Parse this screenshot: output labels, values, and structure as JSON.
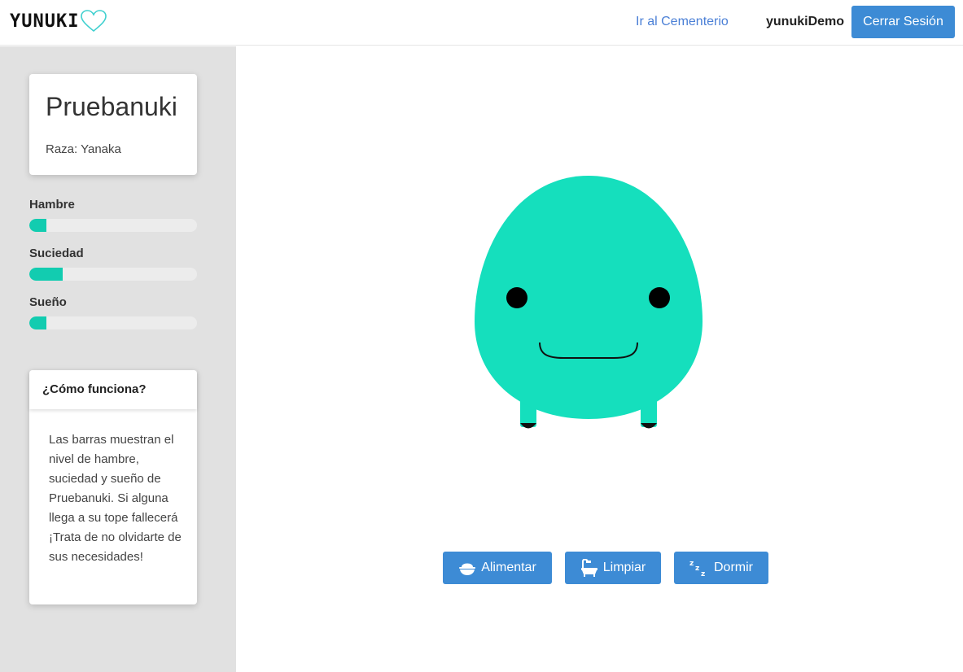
{
  "header": {
    "brand": "YUNUKI",
    "graveyard_link": "Ir al Cementerio",
    "username": "yunukiDemo",
    "logout_label": "Cerrar Sesión",
    "accent_color": "#3d8bd5"
  },
  "pet": {
    "name": "Pruebanuki",
    "breed_text": "Raza: Yanaka",
    "body_color": "#15dfbd"
  },
  "stats": [
    {
      "label": "Hambre",
      "level_percent": 10
    },
    {
      "label": "Suciedad",
      "level_percent": 20
    },
    {
      "label": "Sueño",
      "level_percent": 10
    }
  ],
  "help": {
    "title": "¿Cómo funciona?",
    "body": "Las barras muestran el nivel de hambre, suciedad y sueño de Pruebanuki. Si alguna llega a su tope fallecerá ¡Trata de no olvidarte de sus necesidades!"
  },
  "actions": {
    "feed": {
      "label": "Alimentar",
      "icon": "rice-bowl-icon"
    },
    "clean": {
      "label": "Limpiar",
      "icon": "bathtub-icon"
    },
    "sleep": {
      "label": "Dormir",
      "icon": "zzz-icon"
    }
  }
}
